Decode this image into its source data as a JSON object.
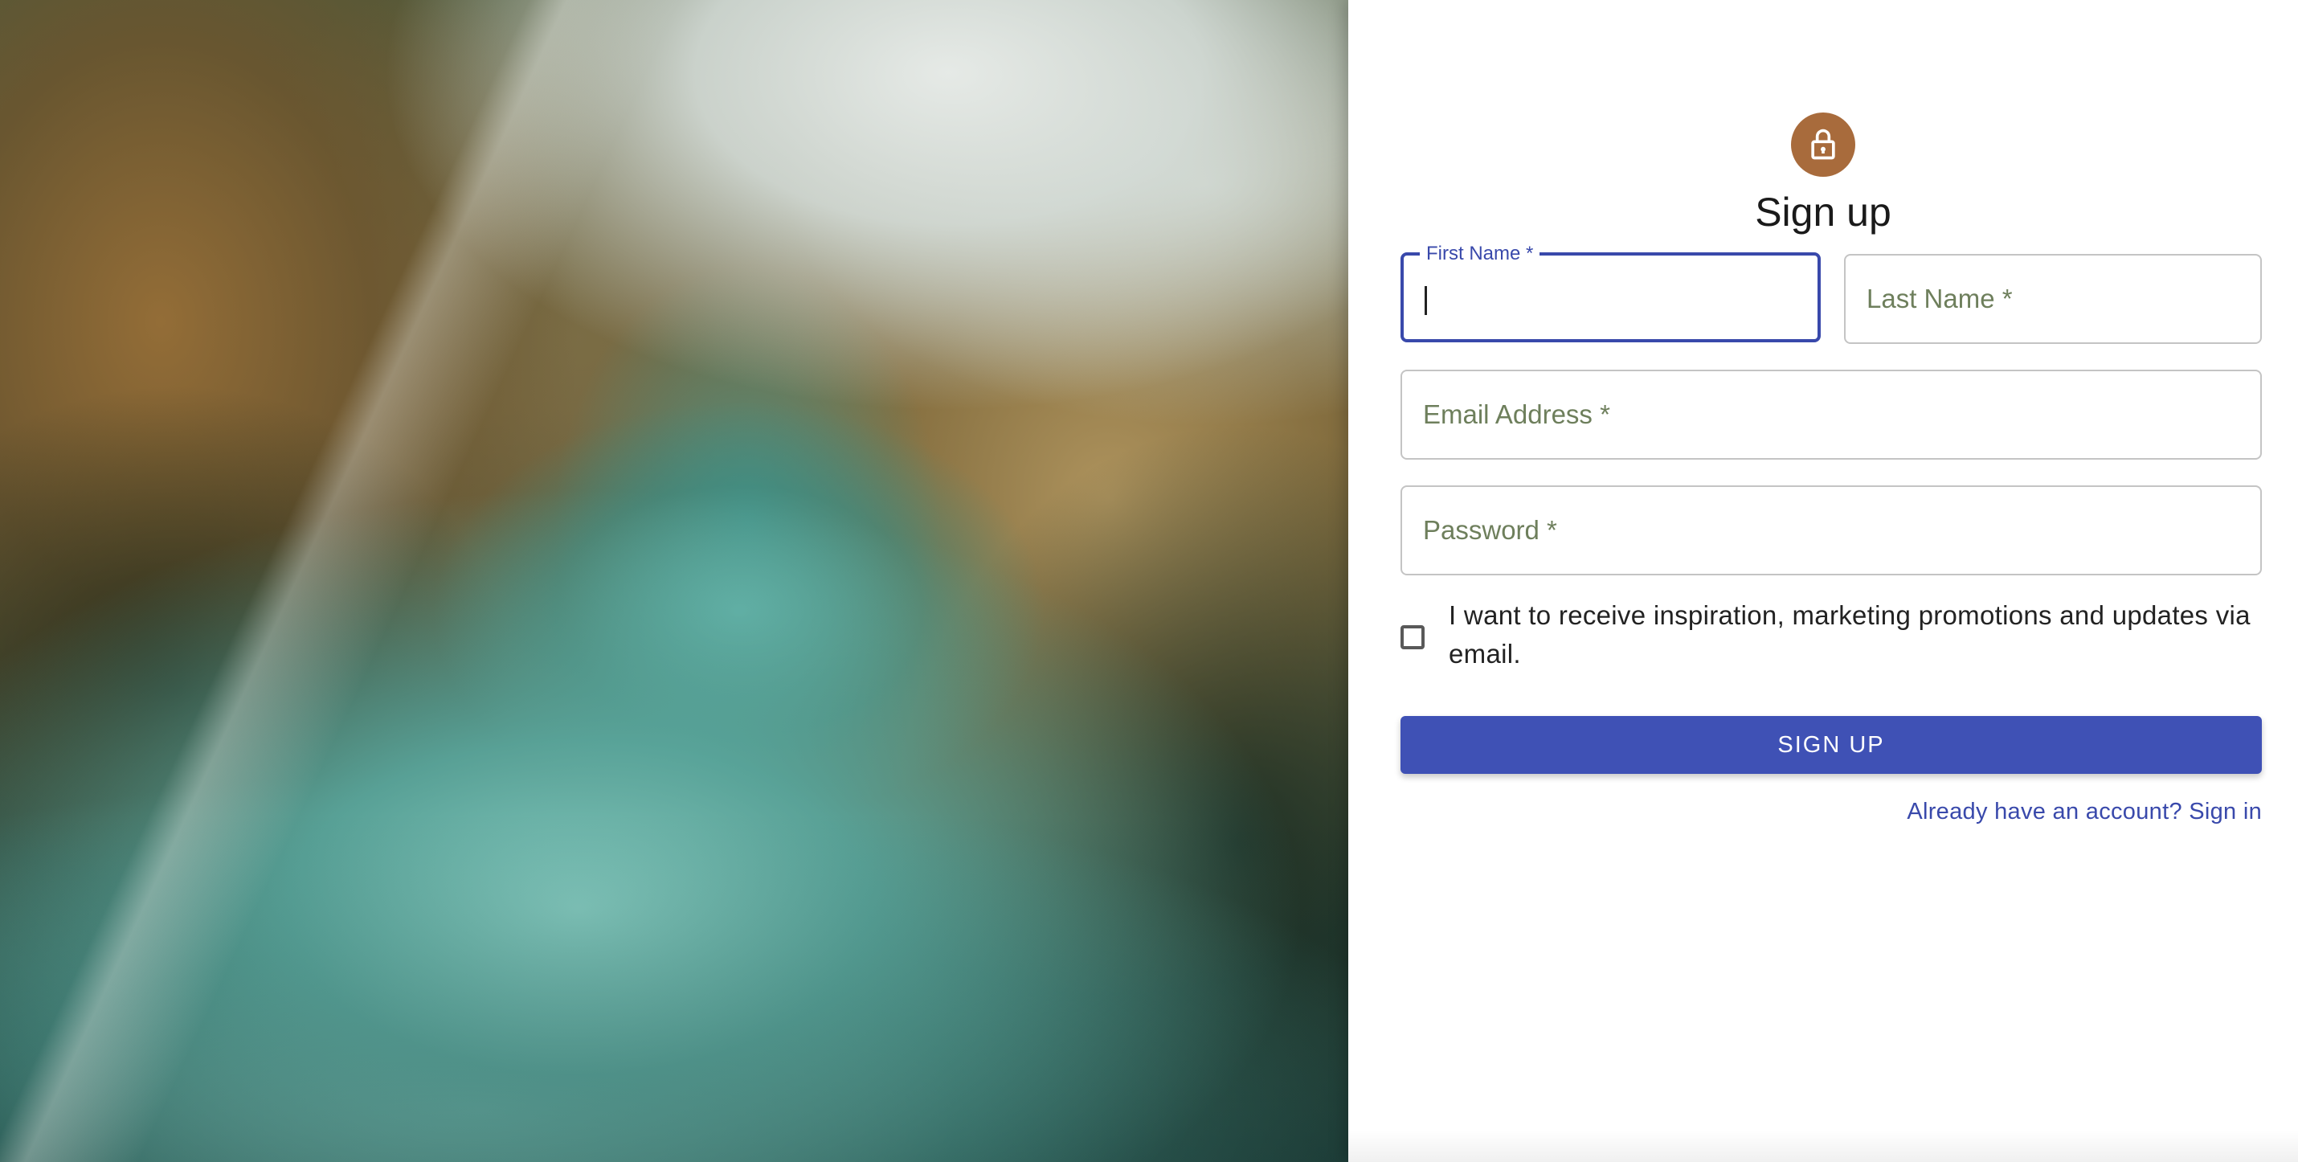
{
  "form": {
    "title": "Sign up",
    "avatar_icon": "lock-icon",
    "first_name_label": "First Name *",
    "last_name_placeholder": "Last Name *",
    "email_placeholder": "Email Address *",
    "password_placeholder": "Password *",
    "marketing_checkbox_label": "I want to receive inspiration, marketing promotions and updates via email.",
    "marketing_checkbox_checked": false,
    "submit_label": "SIGN UP",
    "signin_link": "Already have an account? Sign in"
  },
  "colors": {
    "primary": "#3f51b5",
    "avatar": "#a86b3c",
    "placeholder": "#6e7f5c"
  }
}
